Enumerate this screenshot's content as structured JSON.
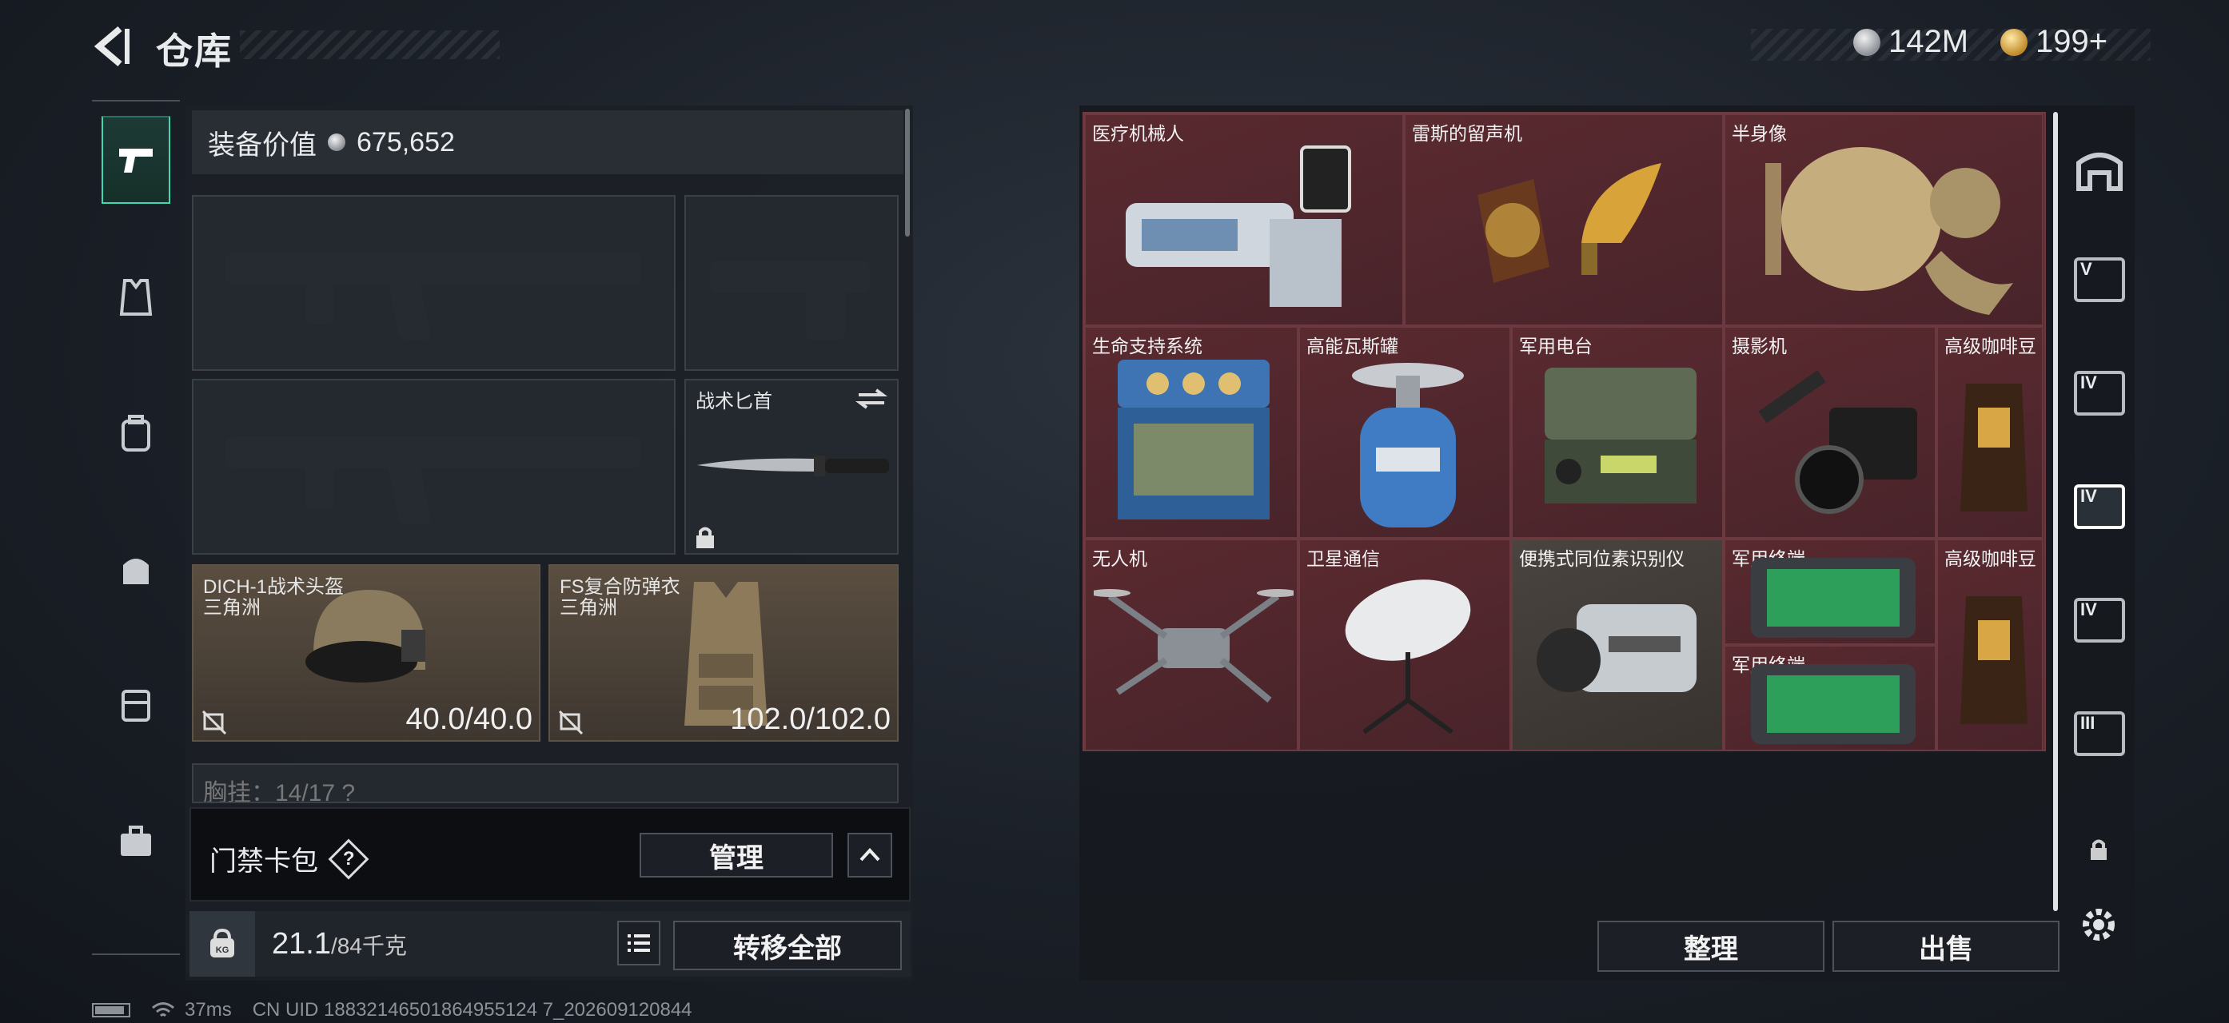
{
  "header": {
    "title": "仓库",
    "currency_silver": "142M",
    "currency_gold": "199+"
  },
  "sidebar": {
    "items": [
      "weapon",
      "vest",
      "backpack",
      "bag",
      "container",
      "case"
    ]
  },
  "loadout": {
    "value_label": "装备价值",
    "value": "675,652",
    "knife_label": "战术匕首",
    "helmet_name": "DICH-1战术头盔",
    "helmet_sub": "三角洲",
    "helmet_durability": "40.0/40.0",
    "armor_name": "FS复合防弹衣",
    "armor_sub": "三角洲",
    "armor_durability": "102.0/102.0",
    "chest_rig_partial": "胸挂：14/17 ?",
    "access_label": "门禁卡包",
    "help": "?",
    "manage_button": "管理",
    "weight_value": "21.1",
    "weight_max": "/84千克",
    "transfer_all_button": "转移全部",
    "kg_label": "KG"
  },
  "inventory": {
    "items": [
      "医疗机械人",
      "雷斯的留声机",
      "半身像",
      "生命支持系统",
      "高能瓦斯罐",
      "军用电台",
      "摄影机",
      "高级咖啡豆",
      "无人机",
      "卫星通信",
      "便携式同位素识别仪",
      "军用终端",
      "军用终端",
      "高级咖啡豆"
    ],
    "sort_button": "整理",
    "sell_button": "出售"
  },
  "right_sidebar": {
    "tiers": [
      "V",
      "IV",
      "IV",
      "IV",
      "III"
    ]
  },
  "status": {
    "ping": "37ms",
    "uid": "CN UID 18832146501864955124 7_202609120844"
  },
  "colors": {
    "accent": "#3fd8b0",
    "grid": "#4b2429"
  }
}
